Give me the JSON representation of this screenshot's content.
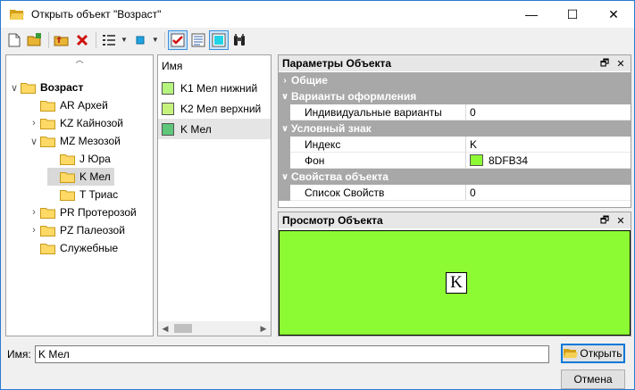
{
  "window": {
    "title": "Открыть объект \"Возраст\"",
    "minimize": "—",
    "maximize": "☐",
    "close": "✕"
  },
  "toolbar": {
    "icons": [
      "new-document-icon",
      "new-folder-icon",
      "folder-up-icon",
      "delete-icon",
      "view-list-icon",
      "view-mode-icon",
      "check-icon",
      "details-icon",
      "preview-icon",
      "binoculars-icon"
    ]
  },
  "tree": {
    "items": [
      {
        "label": "Возраст",
        "expander": "∨",
        "bold": true
      },
      {
        "label": "AR Архей",
        "expander": ""
      },
      {
        "label": "KZ Кайнозой",
        "expander": "›"
      },
      {
        "label": "MZ Мезозой",
        "expander": "∨"
      },
      {
        "label": "J Юра",
        "expander": ""
      },
      {
        "label": "K Мел",
        "expander": "",
        "selected": true
      },
      {
        "label": "T Триас",
        "expander": ""
      },
      {
        "label": "PR Протерозой",
        "expander": "›"
      },
      {
        "label": "PZ Палеозой",
        "expander": "›"
      },
      {
        "label": "Служебные",
        "expander": ""
      }
    ]
  },
  "list": {
    "header": "Имя",
    "rows": [
      {
        "label": "K1 Мел нижний",
        "color": "#B5F57E"
      },
      {
        "label": "K2 Мел верхний",
        "color": "#C5F27D"
      },
      {
        "label": "K Мел",
        "color": "#5EC77A",
        "selected": true
      }
    ]
  },
  "properties": {
    "title": "Параметры Объекта",
    "categories": {
      "general": "Общие",
      "variants": "Варианты оформления",
      "symbol": "Условный знак",
      "object_props": "Свойства объекта"
    },
    "rows": {
      "individual_variants": {
        "name": "Индивидуальные варианты",
        "value": "0"
      },
      "index": {
        "name": "Индекс",
        "value": "K"
      },
      "background": {
        "name": "Фон",
        "value": "8DFB34",
        "color": "#8DFB34"
      },
      "props_list": {
        "name": "Список Свойств",
        "value": "0"
      }
    }
  },
  "preview": {
    "title": "Просмотр Объекта",
    "index": "K",
    "background": "#8DFB34"
  },
  "bottom": {
    "name_label": "Имя:",
    "name_value": "K Мел",
    "open_label": "Открыть",
    "cancel_label": "Отмена"
  }
}
